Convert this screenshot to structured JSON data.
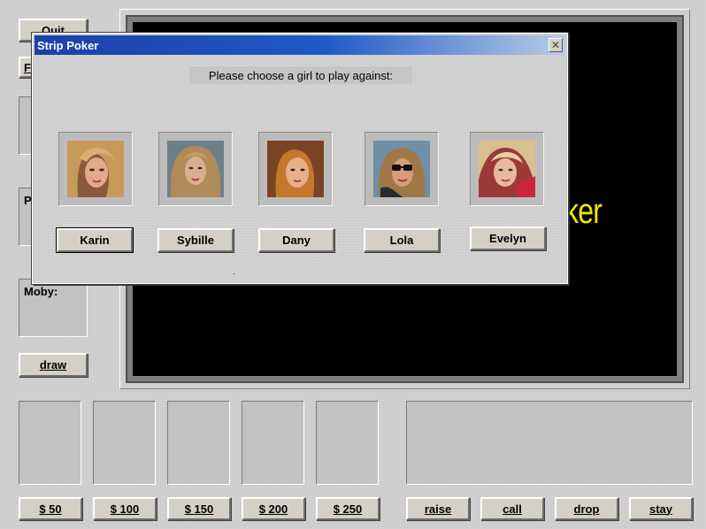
{
  "left_panel": {
    "quit_label": "Quit",
    "f_button_label": "F",
    "player_label": "P",
    "moby_label": "Moby:",
    "draw_label": "draw"
  },
  "game_screen": {
    "title_fragment": "ker",
    "title_color": "#f2e600"
  },
  "bet_buttons": [
    "$ 50",
    "$ 100",
    "$ 150",
    "$ 200",
    "$ 250"
  ],
  "action_buttons": [
    "raise",
    "call",
    "drop",
    "stay"
  ],
  "dialog": {
    "title": "Strip Poker",
    "close_icon": "close-icon",
    "prompt": "Please choose a girl to play against:",
    "girls": [
      {
        "name": "Karin",
        "selected": true
      },
      {
        "name": "Sybille",
        "selected": false
      },
      {
        "name": "Dany",
        "selected": false
      },
      {
        "name": "Lola",
        "selected": false
      },
      {
        "name": "Evelyn",
        "selected": false
      }
    ]
  },
  "colors": {
    "titlebar_start": "#1c3fa8",
    "titlebar_end": "#b8cde6",
    "screen_background": "#000000"
  }
}
